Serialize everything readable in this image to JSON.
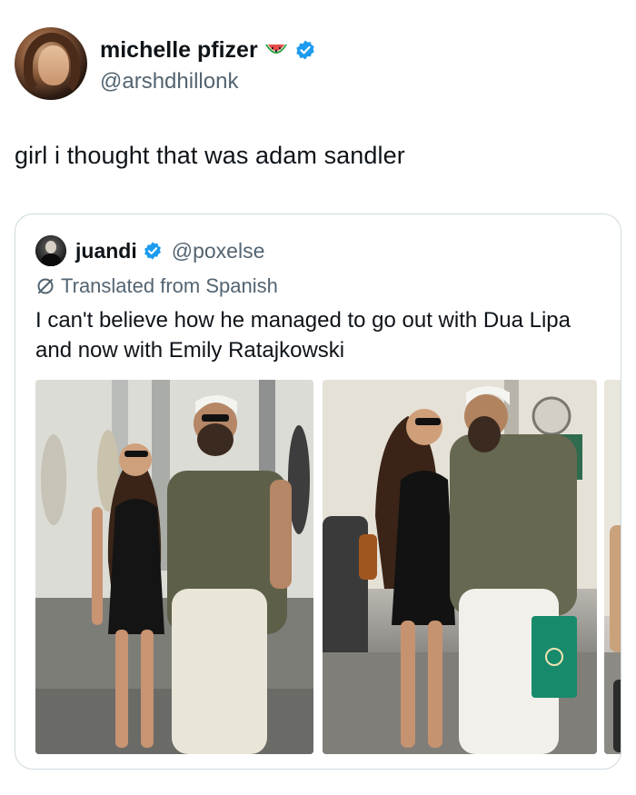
{
  "tweet": {
    "display_name": "michelle pfizer",
    "name_emoji": "watermelon-emoji",
    "handle": "@arshdhillonk",
    "text": "girl i thought that was adam sandler"
  },
  "quote": {
    "display_name": "juandi",
    "handle": "@poxelse",
    "translated_label": "Translated from Spanish",
    "text": "I can't believe how he managed to go out with Dua Lipa and now with Emily Ratajkowski",
    "media_count": 3
  },
  "colors": {
    "verified_blue": "#1d9bf0",
    "secondary_text": "#536471",
    "primary_text": "#0f1419",
    "border": "#cfd9de"
  }
}
